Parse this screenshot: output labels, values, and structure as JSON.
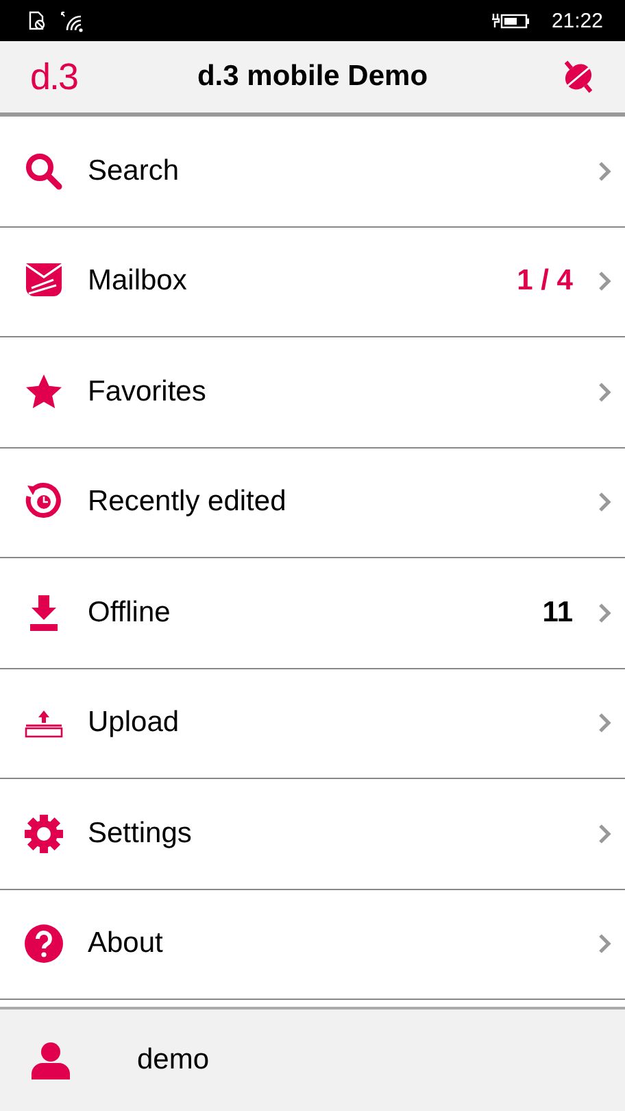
{
  "status_bar": {
    "time": "21:22"
  },
  "header": {
    "logo": "d.3",
    "title": "d.3 mobile Demo"
  },
  "menu": [
    {
      "kind": "search",
      "label": "Search"
    },
    {
      "kind": "mail",
      "label": "Mailbox",
      "badge": {
        "text": "1 / 4",
        "color": "#e0004d"
      }
    },
    {
      "kind": "star",
      "label": "Favorites"
    },
    {
      "kind": "history",
      "label": "Recently edited"
    },
    {
      "kind": "download",
      "label": "Offline",
      "badge": {
        "text": "11",
        "color": "#000000"
      }
    },
    {
      "kind": "upload",
      "label": "Upload"
    },
    {
      "kind": "gear",
      "label": "Settings"
    },
    {
      "kind": "help",
      "label": "About"
    }
  ],
  "user": {
    "name": "demo"
  }
}
